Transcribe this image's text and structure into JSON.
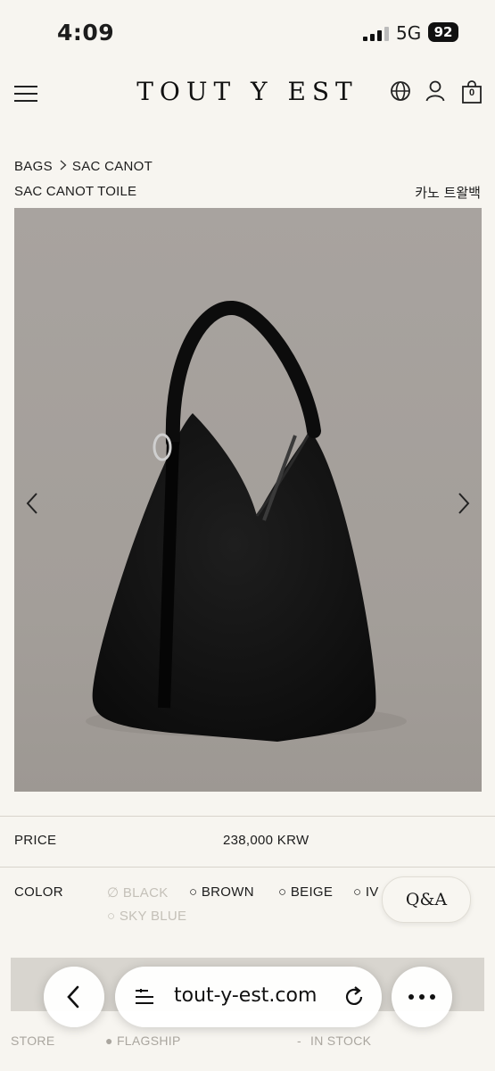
{
  "status_bar": {
    "time": "4:09",
    "network": "5G",
    "battery": "92"
  },
  "header": {
    "logo": "TOUT Y EST",
    "cart_count": "0"
  },
  "breadcrumb": {
    "items": [
      "BAGS",
      "SAC CANOT"
    ]
  },
  "product": {
    "name": "SAC CANOT TOILE",
    "name_ko": "카노 트왈백",
    "price_label": "PRICE",
    "price": "238,000 KRW",
    "color_label": "COLOR",
    "colors": [
      {
        "label": "BLACK",
        "available": false
      },
      {
        "label": "BROWN",
        "available": true
      },
      {
        "label": "BEIGE",
        "available": true
      },
      {
        "label": "IV",
        "available": true
      },
      {
        "label": "SKY BLUE",
        "available": false
      }
    ]
  },
  "qa_button": "Q&A",
  "store_row": {
    "store": "STORE",
    "flagship": "FLAGSHIP",
    "dash": "-",
    "stock": "IN STOCK"
  },
  "browser": {
    "url": "tout-y-est.com"
  },
  "colors": {
    "background": "#f7f5f0",
    "image_bg": "#a39e99",
    "bag": "#111111",
    "disabled": "#c4c0b8"
  }
}
